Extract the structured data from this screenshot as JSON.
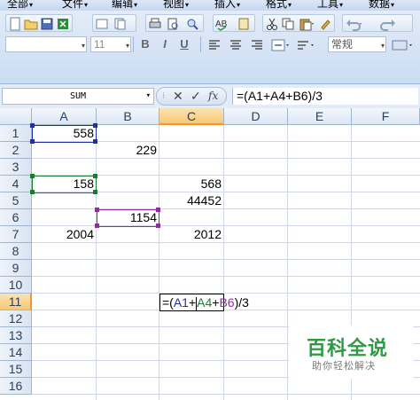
{
  "menu": {
    "items": [
      {
        "label": "全部"
      },
      {
        "label": "文件"
      },
      {
        "label": "编辑"
      },
      {
        "label": "视图"
      },
      {
        "label": "插入"
      },
      {
        "label": "格式"
      },
      {
        "label": "工具"
      },
      {
        "label": "数据"
      }
    ]
  },
  "toolbar": {
    "font_name": "",
    "font_size": "11",
    "bold_label": "B",
    "italic_label": "I",
    "underline_label": "U",
    "number_format": "常规"
  },
  "formula_bar": {
    "name_box": "SUM",
    "cancel_symbol": "✕",
    "enter_symbol": "✓",
    "fx_label": "fx",
    "formula": "=(A1+A4+B6)/3"
  },
  "grid": {
    "columns": [
      "A",
      "B",
      "C",
      "D",
      "E",
      "F"
    ],
    "rows": [
      "1",
      "2",
      "3",
      "4",
      "5",
      "6",
      "7",
      "8",
      "9",
      "10",
      "11",
      "12",
      "13",
      "14",
      "15",
      "16"
    ],
    "selected_column": "C",
    "selected_row": "11",
    "cells": {
      "A1": "558",
      "B2": "229",
      "A4": "158",
      "C4": "568",
      "C5": "44452",
      "B6": "1154",
      "A7": "2004",
      "C7": "2012"
    },
    "edit_cell": {
      "address": "C11",
      "prefix": "=(",
      "ref_a1": "A1",
      "plus1": "+",
      "ref_a4": "A4",
      "plus2": "+",
      "ref_b6": "B6",
      "suffix": ")/3"
    },
    "ref_colors": {
      "A1": "#1f2fa8",
      "A4": "#1d7a32",
      "B6": "#8e2d9e"
    }
  },
  "watermark": {
    "title": "百科全说",
    "subtitle": "助你轻松解决"
  }
}
